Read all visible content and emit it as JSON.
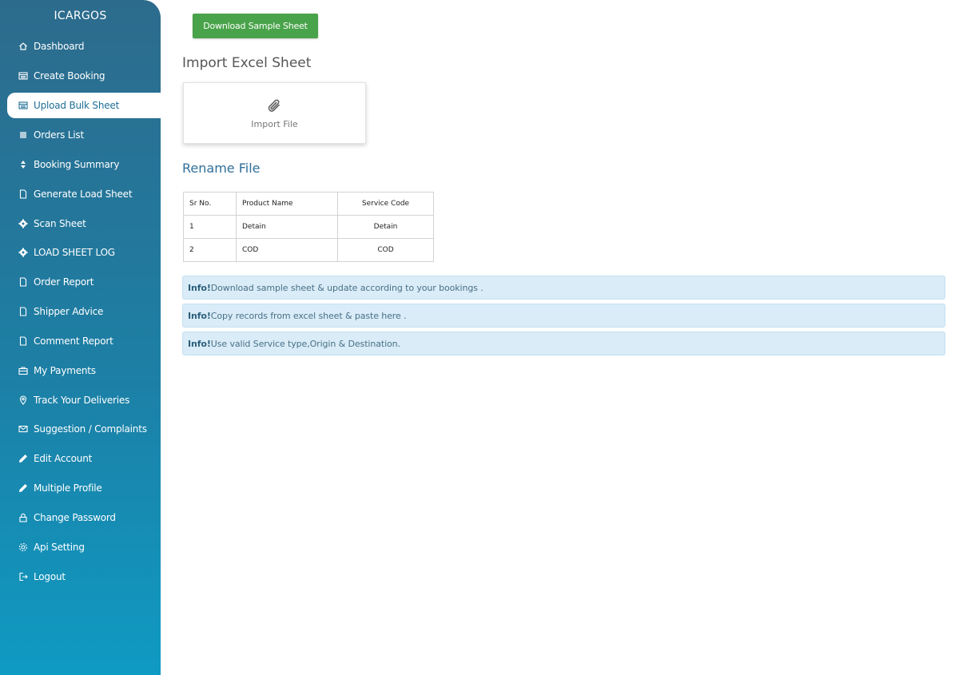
{
  "app": {
    "brand": "ICARGOS"
  },
  "sidebar": {
    "items": [
      {
        "label": "Dashboard",
        "icon": "home-icon"
      },
      {
        "label": "Create Booking",
        "icon": "list-icon"
      },
      {
        "label": "Upload Bulk Sheet",
        "icon": "list-icon",
        "active": true
      },
      {
        "label": "Orders List",
        "icon": "lines-icon"
      },
      {
        "label": "Booking Summary",
        "icon": "sort-icon"
      },
      {
        "label": "Generate Load Sheet",
        "icon": "file-icon"
      },
      {
        "label": "Scan Sheet",
        "icon": "gear-icon"
      },
      {
        "label": "LOAD SHEET LOG",
        "icon": "gear-icon"
      },
      {
        "label": "Order Report",
        "icon": "file-icon"
      },
      {
        "label": "Shipper Advice",
        "icon": "file-icon"
      },
      {
        "label": "Comment Report",
        "icon": "file-icon"
      },
      {
        "label": "My Payments",
        "icon": "briefcase-icon"
      },
      {
        "label": "Track Your Deliveries",
        "icon": "map-pin-icon"
      },
      {
        "label": "Suggestion / Complaints",
        "icon": "mail-icon"
      },
      {
        "label": "Edit Account",
        "icon": "pencil-icon"
      },
      {
        "label": "Multiple Profile",
        "icon": "pencil-icon"
      },
      {
        "label": "Change Password",
        "icon": "lock-icon"
      },
      {
        "label": "Api Setting",
        "icon": "settings-icon"
      },
      {
        "label": "Logout",
        "icon": "logout-icon"
      }
    ]
  },
  "main": {
    "download_button": "Download Sample Sheet",
    "import_heading": "Import Excel Sheet",
    "import_box_label": "Import File",
    "rename_heading": "Rename File",
    "table": {
      "headers": [
        "Sr No.",
        "Product Name",
        "Service Code"
      ],
      "rows": [
        [
          "1",
          "Detain",
          "Detain"
        ],
        [
          "2",
          "COD",
          "COD"
        ]
      ]
    },
    "info": [
      {
        "strong": "Info!",
        "text": " Download sample sheet & update according to your bookings ."
      },
      {
        "strong": "Info!",
        "text": "Copy records from excel sheet & paste here ."
      },
      {
        "strong": "Info!",
        "text": "Use valid Service type,Origin & Destination."
      }
    ]
  },
  "colors": {
    "sidebar_top": "#2d6b8c",
    "sidebar_bottom": "#0f9ac3",
    "download_button": "#49a34a",
    "rename_heading": "#2f6f9a",
    "info_bg": "#d9ecf7"
  }
}
